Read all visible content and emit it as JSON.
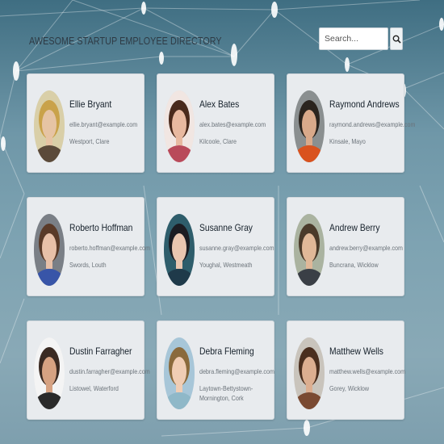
{
  "header": {
    "title": "AWESOME STARTUP EMPLOYEE DIRECTORY",
    "search_placeholder": "Search...",
    "search_icon": "magnifier-icon"
  },
  "employees": [
    {
      "name": "Ellie Bryant",
      "email": "ellie.bryant@example.com",
      "location": "Westport, Clare",
      "hair": "#c9a24a",
      "skin": "#e6c4a4",
      "shirt": "#5b4a3a",
      "bg": "#d9cfa8"
    },
    {
      "name": "Alex Bates",
      "email": "alex.bates@example.com",
      "location": "Kilcoole, Clare",
      "hair": "#4a2a1c",
      "skin": "#e8b9a0",
      "shirt": "#b94a5a",
      "bg": "#f1e6e2"
    },
    {
      "name": "Raymond Andrews",
      "email": "raymond.andrews@example.com",
      "location": "Kinsale, Mayo",
      "hair": "#2b241e",
      "skin": "#d9a98a",
      "shirt": "#d9521e",
      "bg": "#8a8f90"
    },
    {
      "name": "Roberto Hoffman",
      "email": "roberto.hoffman@example.com",
      "location": "Swords, Louth",
      "hair": "#5a3a28",
      "skin": "#e8c0a8",
      "shirt": "#3855a8",
      "bg": "#7a7f86"
    },
    {
      "name": "Susanne Gray",
      "email": "susanne.gray@example.com",
      "location": "Youghal, Westmeath",
      "hair": "#1c1c22",
      "skin": "#eac6b0",
      "shirt": "#1f3a4a",
      "bg": "#2e5d6b"
    },
    {
      "name": "Andrew Berry",
      "email": "andrew.berry@example.com",
      "location": "Buncrana, Wicklow",
      "hair": "#4a3a2a",
      "skin": "#e0b898",
      "shirt": "#3a3f46",
      "bg": "#aab3a0"
    },
    {
      "name": "Dustin Farragher",
      "email": "dustin.farragher@example.com",
      "location": "Listowel, Waterford",
      "hair": "#3a2a22",
      "skin": "#d6a282",
      "shirt": "#2a2a2a",
      "bg": "#f4f4f4"
    },
    {
      "name": "Debra Fleming",
      "email": "debra.fleming@example.com",
      "location": "Laytown-Bettystown-Mornington, Cork",
      "hair": "#8a6a3c",
      "skin": "#f0cdb4",
      "shirt": "#8fb8c8",
      "bg": "#a7c6d8"
    },
    {
      "name": "Matthew Wells",
      "email": "matthew.wells@example.com",
      "location": "Gorey, Wicklow",
      "hair": "#4a2e1e",
      "skin": "#dcae90",
      "shirt": "#7a4a32",
      "bg": "#c9c4bc"
    }
  ]
}
